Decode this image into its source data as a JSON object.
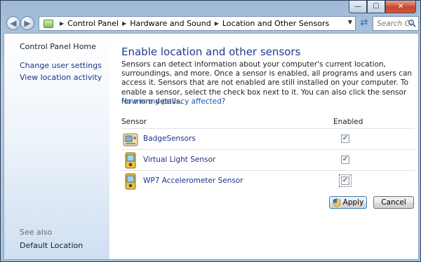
{
  "window": {
    "caption_buttons": {
      "minimize": "—",
      "maximize": "☐",
      "close": "✕"
    }
  },
  "nav": {
    "back_icon": "back-arrow-icon",
    "forward_icon": "forward-arrow-icon",
    "breadcrumbs": [
      "Control Panel",
      "Hardware and Sound",
      "Location and Other Sensors"
    ],
    "search_placeholder": "Search Co..."
  },
  "sidebar": {
    "home": "Control Panel Home",
    "links": [
      "Change user settings",
      "View location activity"
    ],
    "see_also_label": "See also",
    "see_also_links": [
      "Default Location"
    ]
  },
  "main": {
    "title": "Enable location and other sensors",
    "description": "Sensors can detect information about your computer's current location, surroundings, and more. Once a sensor is enabled, all programs and users can access it. Sensors that are not enabled are still installed on your computer. To enable a sensor, select the check box next to it. You can also click the sensor for more details.",
    "privacy_link": "How is my privacy affected?",
    "columns": {
      "sensor": "Sensor",
      "enabled": "Enabled"
    },
    "sensors": [
      {
        "name": "BadgeSensors",
        "enabled": true,
        "icon": "sensor-device-icon"
      },
      {
        "name": "Virtual Light Sensor",
        "enabled": true,
        "icon": "sensor-device-icon"
      },
      {
        "name": "WP7 Accelerometer Sensor",
        "enabled": true,
        "icon": "sensor-device-icon"
      }
    ],
    "apply_label": "Apply",
    "cancel_label": "Cancel"
  },
  "colors": {
    "title": "#1e3b8c",
    "link": "#1e3287",
    "privacy_link": "#1e55b8"
  }
}
